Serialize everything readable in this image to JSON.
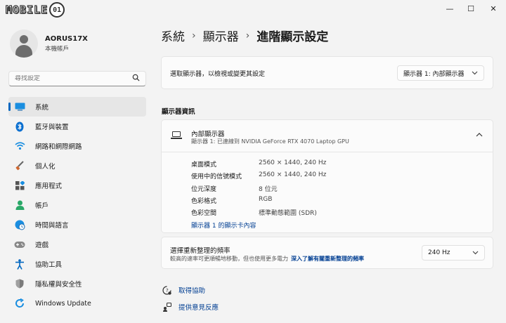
{
  "logo": {
    "text": "MOBILE",
    "badge": "01"
  },
  "window": {
    "minimize": "—",
    "maximize": "☐",
    "close": "✕"
  },
  "profile": {
    "name": "AORUS17X",
    "subtitle": "本機帳戶"
  },
  "search": {
    "placeholder": "尋找設定"
  },
  "nav": {
    "items": [
      {
        "label": "系統",
        "icon": "monitor-icon",
        "color": "#0078d4"
      },
      {
        "label": "藍牙與裝置",
        "icon": "bluetooth-icon",
        "color": "#0078d4"
      },
      {
        "label": "網路和網際網路",
        "icon": "wifi-icon",
        "color": "#0078d4"
      },
      {
        "label": "個人化",
        "icon": "paintbrush-icon",
        "color": "#c05020"
      },
      {
        "label": "應用程式",
        "icon": "apps-icon",
        "color": "#555555"
      },
      {
        "label": "帳戶",
        "icon": "person-icon",
        "color": "#2aa868"
      },
      {
        "label": "時間與語言",
        "icon": "globe-clock-icon",
        "color": "#0078d4"
      },
      {
        "label": "遊戲",
        "icon": "gamepad-icon",
        "color": "#777777"
      },
      {
        "label": "協助工具",
        "icon": "accessibility-icon",
        "color": "#0067c0"
      },
      {
        "label": "隱私權與安全性",
        "icon": "shield-icon",
        "color": "#777777"
      },
      {
        "label": "Windows Update",
        "icon": "update-icon",
        "color": "#0078d4"
      }
    ]
  },
  "breadcrumb": {
    "part1": "系統",
    "part2": "顯示器",
    "part3": "進階顯示設定",
    "sep": "›"
  },
  "display_select": {
    "label": "選取顯示器，以檢視或變更其設定",
    "value": "顯示器 1: 內部顯示器"
  },
  "section": {
    "title": "顯示器資訊"
  },
  "display_info": {
    "title": "內部顯示器",
    "subtitle": "顯示器 1: 已連線到 NVIDIA GeForce RTX 4070 Laptop GPU",
    "rows": [
      {
        "key": "桌面模式",
        "value": "2560 × 1440, 240 Hz"
      },
      {
        "key": "使用中的信號模式",
        "value": "2560 × 1440, 240 Hz"
      },
      {
        "key": "位元深度",
        "value": "8 位元"
      },
      {
        "key": "色彩格式",
        "value": "RGB"
      },
      {
        "key": "色彩空間",
        "value": "標準動態範圍 (SDR)"
      }
    ],
    "adapter_link": "顯示器 1 的顯示卡內容"
  },
  "refresh": {
    "label": "選擇重新整理的頻率",
    "description": "較高的速率可更順暢地移動，但也使用更多電力",
    "link": "深入了解有關重新整理的頻率",
    "value": "240 Hz"
  },
  "help": {
    "get_help": "取得協助",
    "feedback": "提供意見反應"
  }
}
